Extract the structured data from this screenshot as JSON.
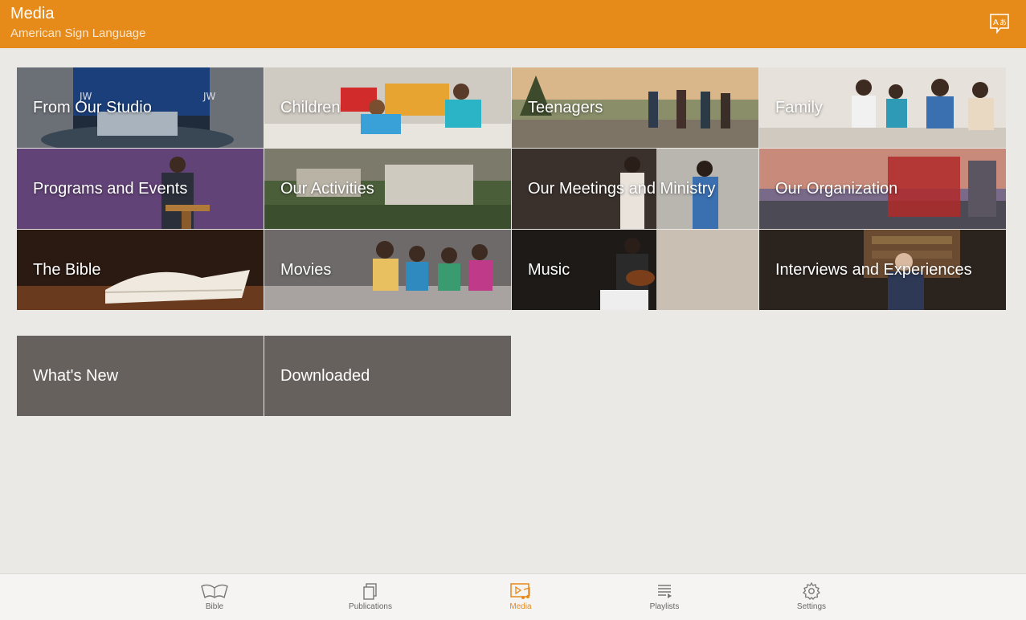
{
  "header": {
    "title": "Media",
    "subtitle": "American Sign Language"
  },
  "categories": [
    {
      "label": "From Our Studio"
    },
    {
      "label": "Children"
    },
    {
      "label": "Teenagers"
    },
    {
      "label": "Family"
    },
    {
      "label": "Programs and Events"
    },
    {
      "label": "Our Activities"
    },
    {
      "label": "Our Meetings and Ministry"
    },
    {
      "label": "Our Organization"
    },
    {
      "label": "The Bible"
    },
    {
      "label": "Movies"
    },
    {
      "label": "Music"
    },
    {
      "label": "Interviews and Experiences"
    }
  ],
  "extra_tiles": [
    {
      "label": "What's New"
    },
    {
      "label": "Downloaded"
    }
  ],
  "bottom_nav": [
    {
      "label": "Bible",
      "icon": "bible-icon"
    },
    {
      "label": "Publications",
      "icon": "publications-icon"
    },
    {
      "label": "Media",
      "icon": "media-icon",
      "active": true
    },
    {
      "label": "Playlists",
      "icon": "playlists-icon"
    },
    {
      "label": "Settings",
      "icon": "settings-icon"
    }
  ],
  "colors": {
    "accent": "#e68a1a",
    "tile_gray": "#67615d",
    "background": "#ebe9e6"
  }
}
